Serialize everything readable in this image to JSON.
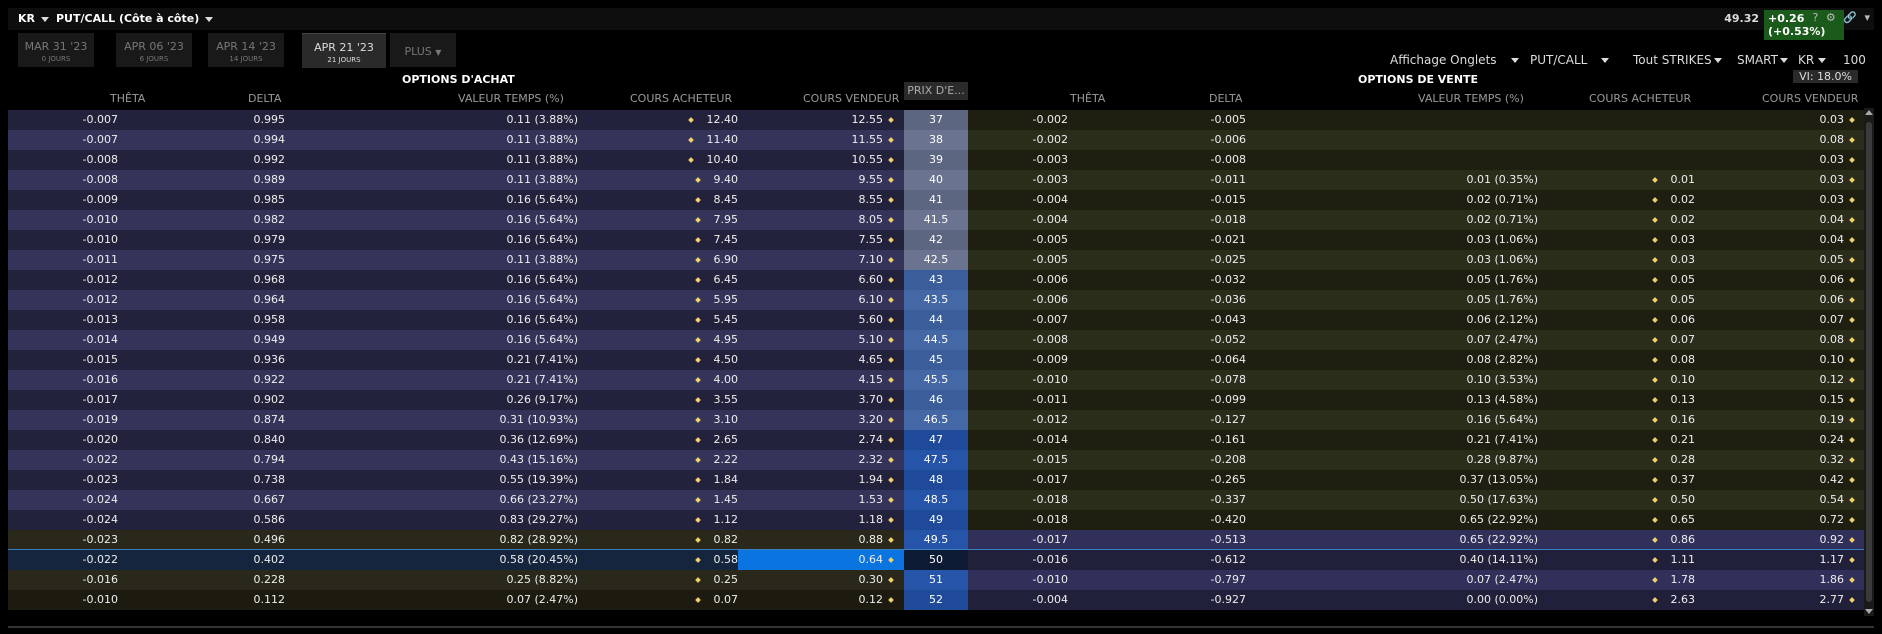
{
  "header": {
    "symbol": "KR",
    "mode": "PUT/CALL (Côte à côte)",
    "last_price": "49.32",
    "change": "+0.26 (+0.53%)",
    "help": "?"
  },
  "expiry_tabs": [
    {
      "label": "MAR 31 '23",
      "sub": "0 JOURS",
      "active": false
    },
    {
      "label": "APR 06 '23",
      "sub": "6 JOURS",
      "active": false
    },
    {
      "label": "APR 14 '23",
      "sub": "14 JOURS",
      "active": false
    },
    {
      "label": "APR 21 '23",
      "sub": "21 JOURS",
      "active": true
    },
    {
      "label": "PLUS",
      "sub": "",
      "active": false
    }
  ],
  "toolbar": {
    "display": "Affichage Onglets",
    "putcall": "PUT/CALL",
    "strikes": "Tout STRIKES",
    "exchange": "SMART",
    "underlying": "KR",
    "multiplier": "100",
    "vi": "VI: 18.0%"
  },
  "calls": {
    "title": "OPTIONS D'ACHAT",
    "headers": [
      "THÊTA",
      "DELTA",
      "VALEUR TEMPS (%)",
      "COURS ACHETEUR",
      "COURS VENDEUR"
    ]
  },
  "puts": {
    "title": "OPTIONS DE VENTE",
    "headers": [
      "THÊTA",
      "DELTA",
      "VALEUR TEMPS (%)",
      "COURS ACHETEUR",
      "COURS VENDEUR"
    ]
  },
  "strike_header": "PRIX D'E...",
  "rows": [
    {
      "strike": "37",
      "c_theta": "-0.007",
      "c_delta": "0.995",
      "c_tv": "0.11 (3.88%)",
      "c_bid": "12.40",
      "c_ask": "12.55",
      "p_theta": "-0.002",
      "p_delta": "-0.005",
      "p_tv": "",
      "p_bid": "",
      "p_ask": "0.03"
    },
    {
      "strike": "38",
      "c_theta": "-0.007",
      "c_delta": "0.994",
      "c_tv": "0.11 (3.88%)",
      "c_bid": "11.40",
      "c_ask": "11.55",
      "p_theta": "-0.002",
      "p_delta": "-0.006",
      "p_tv": "",
      "p_bid": "",
      "p_ask": "0.08"
    },
    {
      "strike": "39",
      "c_theta": "-0.008",
      "c_delta": "0.992",
      "c_tv": "0.11 (3.88%)",
      "c_bid": "10.40",
      "c_ask": "10.55",
      "p_theta": "-0.003",
      "p_delta": "-0.008",
      "p_tv": "",
      "p_bid": "",
      "p_ask": "0.03"
    },
    {
      "strike": "40",
      "c_theta": "-0.008",
      "c_delta": "0.989",
      "c_tv": "0.11 (3.88%)",
      "c_bid": "9.40",
      "c_ask": "9.55",
      "p_theta": "-0.003",
      "p_delta": "-0.011",
      "p_tv": "0.01 (0.35%)",
      "p_bid": "0.01",
      "p_ask": "0.03"
    },
    {
      "strike": "41",
      "c_theta": "-0.009",
      "c_delta": "0.985",
      "c_tv": "0.16 (5.64%)",
      "c_bid": "8.45",
      "c_ask": "8.55",
      "p_theta": "-0.004",
      "p_delta": "-0.015",
      "p_tv": "0.02 (0.71%)",
      "p_bid": "0.02",
      "p_ask": "0.03"
    },
    {
      "strike": "41.5",
      "c_theta": "-0.010",
      "c_delta": "0.982",
      "c_tv": "0.16 (5.64%)",
      "c_bid": "7.95",
      "c_ask": "8.05",
      "p_theta": "-0.004",
      "p_delta": "-0.018",
      "p_tv": "0.02 (0.71%)",
      "p_bid": "0.02",
      "p_ask": "0.04"
    },
    {
      "strike": "42",
      "c_theta": "-0.010",
      "c_delta": "0.979",
      "c_tv": "0.16 (5.64%)",
      "c_bid": "7.45",
      "c_ask": "7.55",
      "p_theta": "-0.005",
      "p_delta": "-0.021",
      "p_tv": "0.03 (1.06%)",
      "p_bid": "0.03",
      "p_ask": "0.04"
    },
    {
      "strike": "42.5",
      "c_theta": "-0.011",
      "c_delta": "0.975",
      "c_tv": "0.11 (3.88%)",
      "c_bid": "6.90",
      "c_ask": "7.10",
      "p_theta": "-0.005",
      "p_delta": "-0.025",
      "p_tv": "0.03 (1.06%)",
      "p_bid": "0.03",
      "p_ask": "0.05"
    },
    {
      "strike": "43",
      "c_theta": "-0.012",
      "c_delta": "0.968",
      "c_tv": "0.16 (5.64%)",
      "c_bid": "6.45",
      "c_ask": "6.60",
      "p_theta": "-0.006",
      "p_delta": "-0.032",
      "p_tv": "0.05 (1.76%)",
      "p_bid": "0.05",
      "p_ask": "0.06"
    },
    {
      "strike": "43.5",
      "c_theta": "-0.012",
      "c_delta": "0.964",
      "c_tv": "0.16 (5.64%)",
      "c_bid": "5.95",
      "c_ask": "6.10",
      "p_theta": "-0.006",
      "p_delta": "-0.036",
      "p_tv": "0.05 (1.76%)",
      "p_bid": "0.05",
      "p_ask": "0.06"
    },
    {
      "strike": "44",
      "c_theta": "-0.013",
      "c_delta": "0.958",
      "c_tv": "0.16 (5.64%)",
      "c_bid": "5.45",
      "c_ask": "5.60",
      "p_theta": "-0.007",
      "p_delta": "-0.043",
      "p_tv": "0.06 (2.12%)",
      "p_bid": "0.06",
      "p_ask": "0.07"
    },
    {
      "strike": "44.5",
      "c_theta": "-0.014",
      "c_delta": "0.949",
      "c_tv": "0.16 (5.64%)",
      "c_bid": "4.95",
      "c_ask": "5.10",
      "p_theta": "-0.008",
      "p_delta": "-0.052",
      "p_tv": "0.07 (2.47%)",
      "p_bid": "0.07",
      "p_ask": "0.08"
    },
    {
      "strike": "45",
      "c_theta": "-0.015",
      "c_delta": "0.936",
      "c_tv": "0.21 (7.41%)",
      "c_bid": "4.50",
      "c_ask": "4.65",
      "p_theta": "-0.009",
      "p_delta": "-0.064",
      "p_tv": "0.08 (2.82%)",
      "p_bid": "0.08",
      "p_ask": "0.10"
    },
    {
      "strike": "45.5",
      "c_theta": "-0.016",
      "c_delta": "0.922",
      "c_tv": "0.21 (7.41%)",
      "c_bid": "4.00",
      "c_ask": "4.15",
      "p_theta": "-0.010",
      "p_delta": "-0.078",
      "p_tv": "0.10 (3.53%)",
      "p_bid": "0.10",
      "p_ask": "0.12"
    },
    {
      "strike": "46",
      "c_theta": "-0.017",
      "c_delta": "0.902",
      "c_tv": "0.26 (9.17%)",
      "c_bid": "3.55",
      "c_ask": "3.70",
      "p_theta": "-0.011",
      "p_delta": "-0.099",
      "p_tv": "0.13 (4.58%)",
      "p_bid": "0.13",
      "p_ask": "0.15"
    },
    {
      "strike": "46.5",
      "c_theta": "-0.019",
      "c_delta": "0.874",
      "c_tv": "0.31 (10.93%)",
      "c_bid": "3.10",
      "c_ask": "3.20",
      "p_theta": "-0.012",
      "p_delta": "-0.127",
      "p_tv": "0.16 (5.64%)",
      "p_bid": "0.16",
      "p_ask": "0.19"
    },
    {
      "strike": "47",
      "c_theta": "-0.020",
      "c_delta": "0.840",
      "c_tv": "0.36 (12.69%)",
      "c_bid": "2.65",
      "c_ask": "2.74",
      "p_theta": "-0.014",
      "p_delta": "-0.161",
      "p_tv": "0.21 (7.41%)",
      "p_bid": "0.21",
      "p_ask": "0.24"
    },
    {
      "strike": "47.5",
      "c_theta": "-0.022",
      "c_delta": "0.794",
      "c_tv": "0.43 (15.16%)",
      "c_bid": "2.22",
      "c_ask": "2.32",
      "p_theta": "-0.015",
      "p_delta": "-0.208",
      "p_tv": "0.28 (9.87%)",
      "p_bid": "0.28",
      "p_ask": "0.32"
    },
    {
      "strike": "48",
      "c_theta": "-0.023",
      "c_delta": "0.738",
      "c_tv": "0.55 (19.39%)",
      "c_bid": "1.84",
      "c_ask": "1.94",
      "p_theta": "-0.017",
      "p_delta": "-0.265",
      "p_tv": "0.37 (13.05%)",
      "p_bid": "0.37",
      "p_ask": "0.42"
    },
    {
      "strike": "48.5",
      "c_theta": "-0.024",
      "c_delta": "0.667",
      "c_tv": "0.66 (23.27%)",
      "c_bid": "1.45",
      "c_ask": "1.53",
      "p_theta": "-0.018",
      "p_delta": "-0.337",
      "p_tv": "0.50 (17.63%)",
      "p_bid": "0.50",
      "p_ask": "0.54"
    },
    {
      "strike": "49",
      "c_theta": "-0.024",
      "c_delta": "0.586",
      "c_tv": "0.83 (29.27%)",
      "c_bid": "1.12",
      "c_ask": "1.18",
      "p_theta": "-0.018",
      "p_delta": "-0.420",
      "p_tv": "0.65 (22.92%)",
      "p_bid": "0.65",
      "p_ask": "0.72"
    },
    {
      "strike": "49.5",
      "c_theta": "-0.023",
      "c_delta": "0.496",
      "c_tv": "0.82 (28.92%)",
      "c_bid": "0.82",
      "c_ask": "0.88",
      "p_theta": "-0.017",
      "p_delta": "-0.513",
      "p_tv": "0.65 (22.92%)",
      "p_bid": "0.86",
      "p_ask": "0.92"
    },
    {
      "strike": "50",
      "c_theta": "-0.022",
      "c_delta": "0.402",
      "c_tv": "0.58 (20.45%)",
      "c_bid": "0.58",
      "c_ask": "0.64",
      "p_theta": "-0.016",
      "p_delta": "-0.612",
      "p_tv": "0.40 (14.11%)",
      "p_bid": "1.11",
      "p_ask": "1.17",
      "selected": true
    },
    {
      "strike": "51",
      "c_theta": "-0.016",
      "c_delta": "0.228",
      "c_tv": "0.25 (8.82%)",
      "c_bid": "0.25",
      "c_ask": "0.30",
      "p_theta": "-0.010",
      "p_delta": "-0.797",
      "p_tv": "0.07 (2.47%)",
      "p_bid": "1.78",
      "p_ask": "1.86"
    },
    {
      "strike": "52",
      "c_theta": "-0.010",
      "c_delta": "0.112",
      "c_tv": "0.07 (2.47%)",
      "c_bid": "0.07",
      "c_ask": "0.12",
      "p_theta": "-0.004",
      "p_delta": "-0.927",
      "p_tv": "0.00 (0.00%)",
      "p_bid": "2.63",
      "p_ask": "2.77"
    }
  ]
}
